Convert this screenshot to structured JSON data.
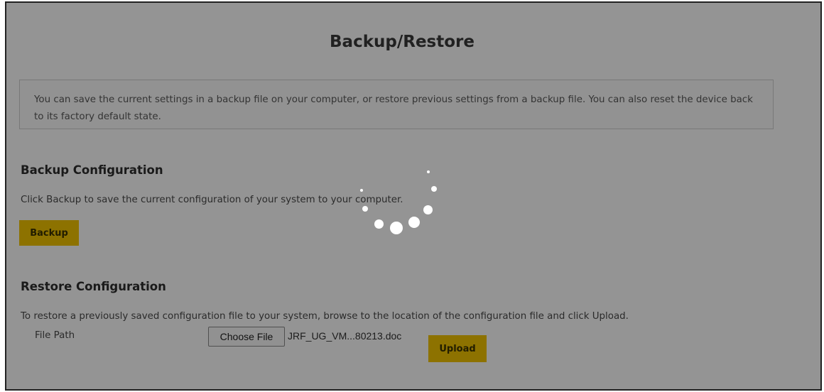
{
  "page": {
    "title": "Backup/Restore",
    "info_text": "You can save the current settings in a backup file on your computer, or restore previous settings from a backup file. You can also reset the device back to its factory default state."
  },
  "backup": {
    "heading": "Backup Configuration",
    "description": "Click Backup to save the current configuration of your system to your computer.",
    "button_label": "Backup"
  },
  "restore": {
    "heading": "Restore Configuration",
    "description": "To restore a previously saved configuration file to your system, browse to the location of the configuration file and click Upload.",
    "file_path_label": "File Path",
    "choose_file_label": "Choose File",
    "selected_file": "JRF_UG_VM...80213.doc",
    "upload_label": "Upload"
  },
  "loading": {
    "icon": "loading-spinner-icon"
  },
  "colors": {
    "accent": "#f3c400",
    "overlay": "rgba(0,0,0,0.42)"
  }
}
